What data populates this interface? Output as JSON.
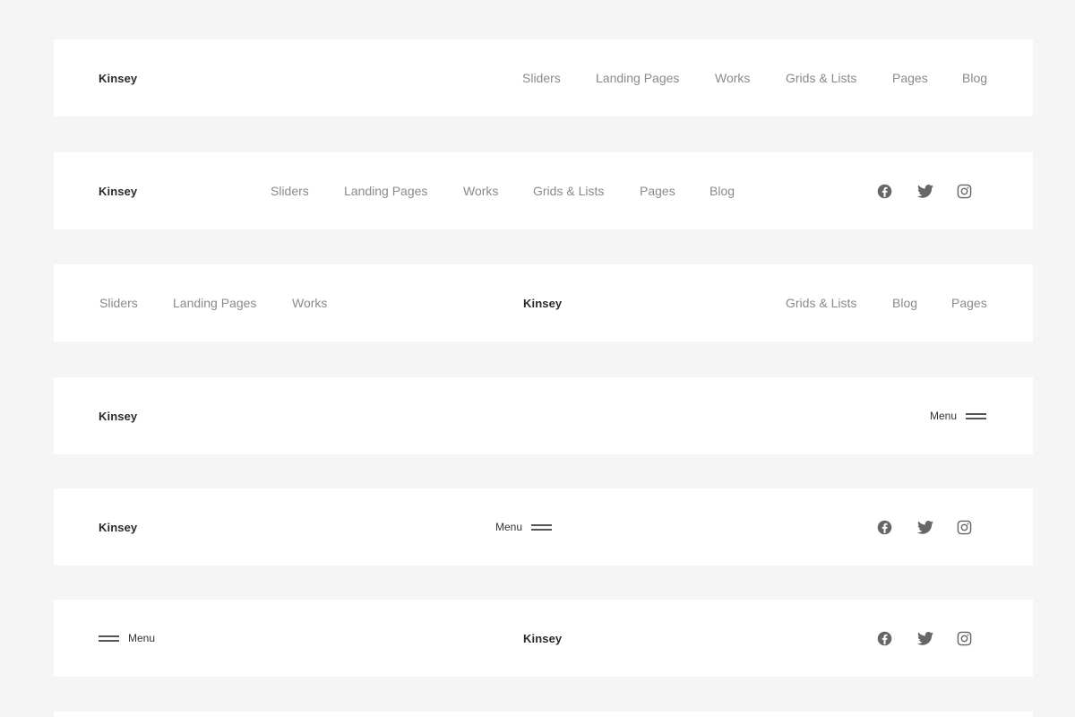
{
  "brand": "Kinsey",
  "menu_label": "Menu",
  "icon_color": "#666666",
  "nav_color": "#8a8a8a",
  "bar1": {
    "nav": [
      "Sliders",
      "Landing Pages",
      "Works",
      "Grids & Lists",
      "Pages",
      "Blog"
    ]
  },
  "bar2": {
    "nav": [
      "Sliders",
      "Landing Pages",
      "Works",
      "Grids & Lists",
      "Pages",
      "Blog"
    ],
    "social": [
      "facebook-icon",
      "twitter-icon",
      "instagram-icon"
    ]
  },
  "bar3": {
    "left_nav": [
      "Sliders",
      "Landing Pages",
      "Works"
    ],
    "right_nav": [
      "Grids & Lists",
      "Blog",
      "Pages"
    ]
  },
  "bar5": {
    "social": [
      "facebook-icon",
      "twitter-icon",
      "instagram-icon"
    ]
  },
  "bar6": {
    "social": [
      "facebook-icon",
      "twitter-icon",
      "instagram-icon"
    ]
  }
}
